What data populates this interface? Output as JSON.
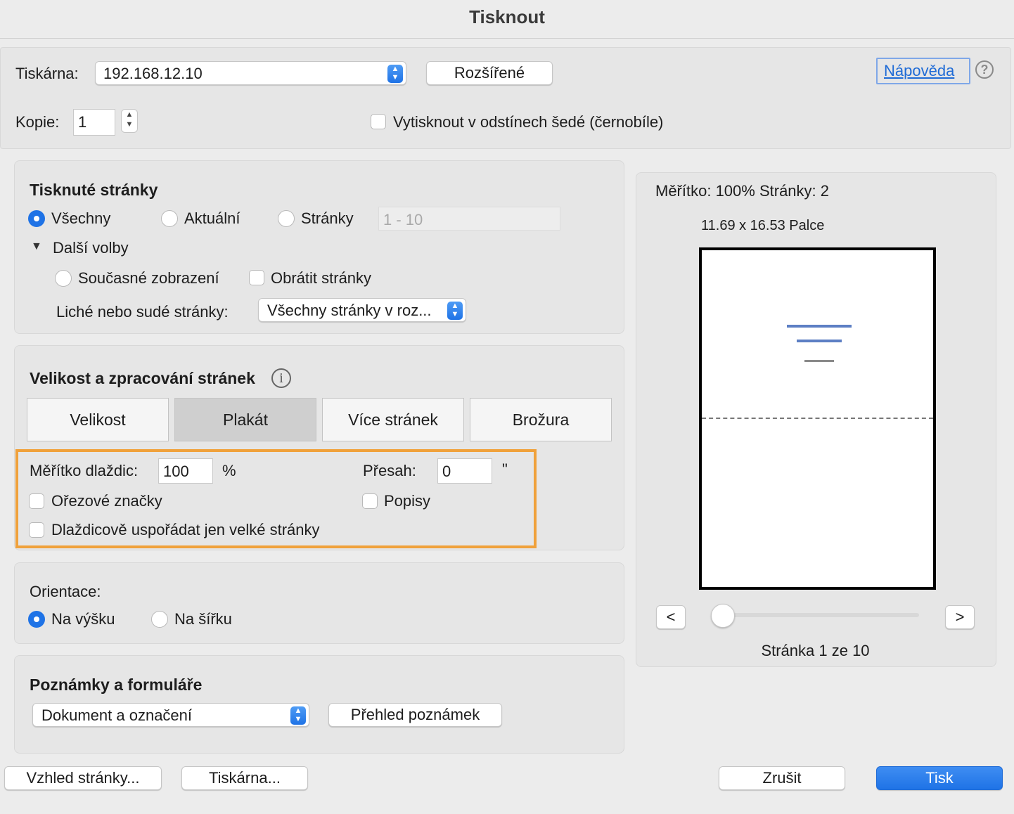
{
  "window": {
    "title": "Tisknout"
  },
  "printer": {
    "label": "Tiskárna:",
    "value": "192.168.12.10",
    "advanced_button": "Rozšířené",
    "help_link": "Nápověda",
    "help_icon_glyph": "?"
  },
  "copies": {
    "label": "Kopie:",
    "value": "1"
  },
  "grayscale": {
    "label": "Vytisknout v odstínech šedé (černobíle)",
    "checked": false
  },
  "pages_section": {
    "heading": "Tisknuté stránky",
    "options": [
      "Všechny",
      "Aktuální",
      "Stránky"
    ],
    "selected": "Všechny",
    "range_placeholder": "1 - 10",
    "more_options": "Další volby",
    "current_view": "Současné zobrazení",
    "reverse_pages": "Obrátit stránky",
    "odd_even_label": "Liché nebo sudé stránky:",
    "odd_even_value": "Všechny stránky v roz..."
  },
  "sizing_section": {
    "heading": "Velikost a zpracování stránek",
    "info_glyph": "i",
    "tabs": [
      "Velikost",
      "Plakát",
      "Více stránek",
      "Brožura"
    ],
    "active_tab": "Plakát",
    "tile_scale_label": "Měřítko dlaždic:",
    "tile_scale_value": "100",
    "tile_scale_unit": "%",
    "overlap_label": "Přesah:",
    "overlap_value": "0",
    "overlap_unit": "\"",
    "cut_marks": "Ořezové značky",
    "labels": "Popisy",
    "tile_large_only": "Dlaždicově uspořádat jen velké stránky",
    "highlight_color": "#f0a13b"
  },
  "orientation": {
    "label": "Orientace:",
    "portrait": "Na výšku",
    "landscape": "Na šířku",
    "selected": "Na výšku"
  },
  "comments": {
    "heading": "Poznámky a formuláře",
    "select_value": "Dokument a označení",
    "summary_button": "Přehled poznámek"
  },
  "preview": {
    "scale_pages": "Měřítko: 100% Stránky: 2",
    "paper_size": "11.69 x 16.53 Palce",
    "prev": "<",
    "next": ">",
    "page_indicator": "Stránka 1 ze 10",
    "slider_position": 0
  },
  "footer": {
    "page_setup": "Vzhled stránky...",
    "printer": "Tiskárna...",
    "cancel": "Zrušit",
    "print": "Tisk"
  },
  "colors": {
    "accent": "#1f73e6",
    "highlight": "#f0a13b"
  }
}
